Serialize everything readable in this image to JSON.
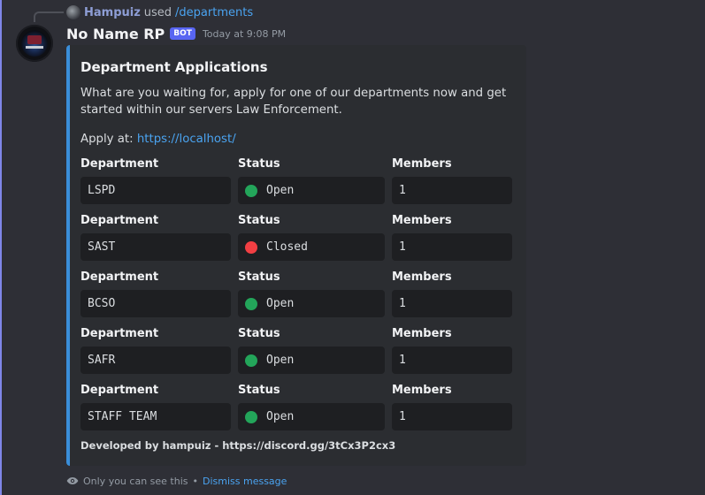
{
  "reply": {
    "user": "Hampuiz",
    "used_text": "used",
    "command": "/departments"
  },
  "message": {
    "author": "No Name RP",
    "badge": "BOT",
    "timestamp": "Today at 9:08 PM"
  },
  "embed": {
    "accent_color": "#3a8ed9",
    "title": "Department Applications",
    "description": "What are you waiting for, apply for one of our departments now and get started within our servers Law Enforcement.",
    "apply_label": "Apply at:",
    "apply_link": "https://localhost/",
    "field_headers": {
      "department": "Department",
      "status": "Status",
      "members": "Members"
    },
    "rows": [
      {
        "department": "LSPD",
        "status": "Open",
        "status_color": "#23a55a",
        "members": "1"
      },
      {
        "department": "SAST",
        "status": "Closed",
        "status_color": "#f23f43",
        "members": "1"
      },
      {
        "department": "BCSO",
        "status": "Open",
        "status_color": "#23a55a",
        "members": "1"
      },
      {
        "department": "SAFR",
        "status": "Open",
        "status_color": "#23a55a",
        "members": "1"
      },
      {
        "department": "STAFF TEAM",
        "status": "Open",
        "status_color": "#23a55a",
        "members": "1"
      }
    ],
    "footer": "Developed by hampuiz - https://discord.gg/3tCx3P2cx3"
  },
  "ephemeral": {
    "icon": "eye-icon",
    "note": "Only you can see this",
    "separator": "•",
    "dismiss": "Dismiss message"
  }
}
